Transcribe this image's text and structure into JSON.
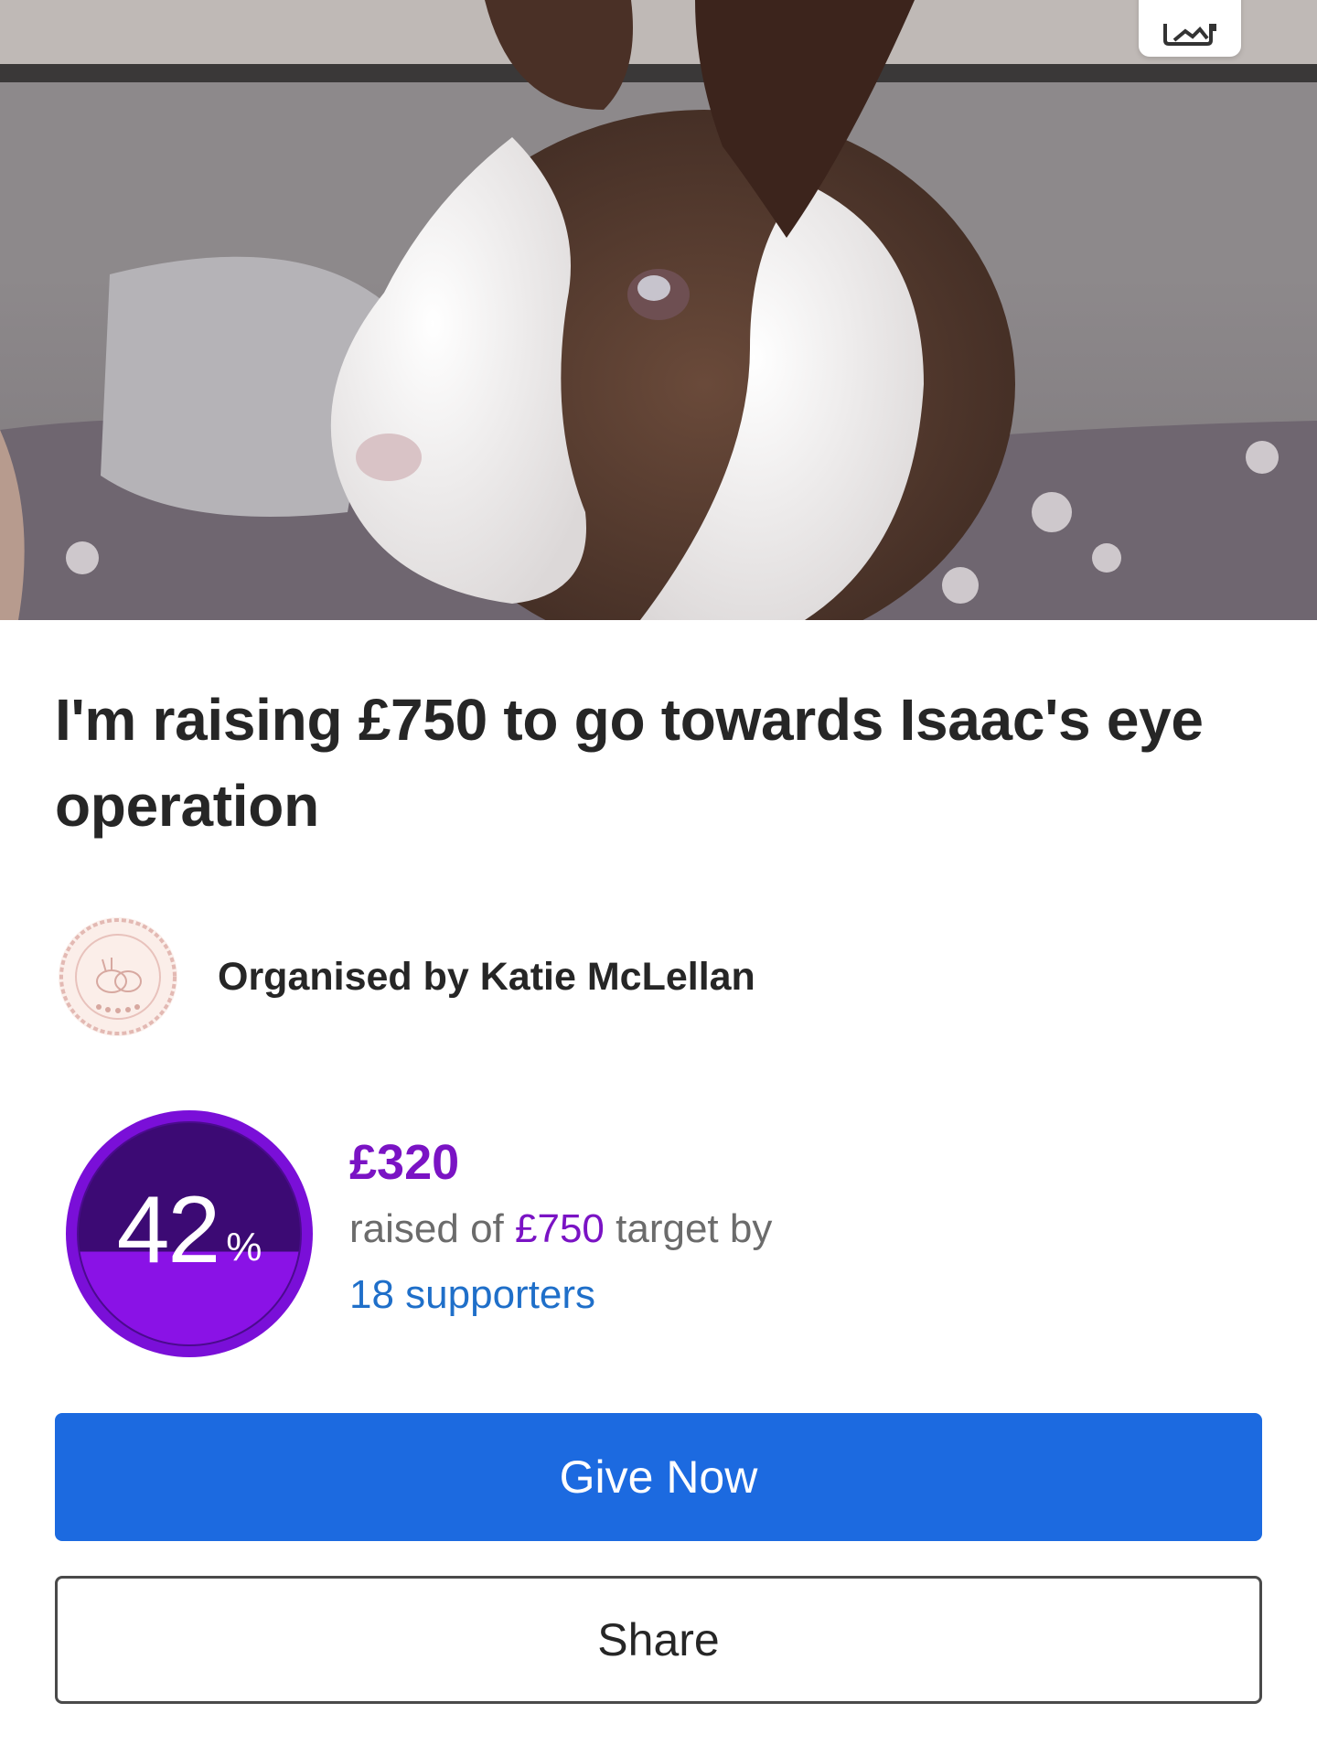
{
  "hero": {
    "image": "rabbit-photo",
    "gallery_icon": "image-gallery-icon"
  },
  "fundraiser": {
    "title": "I'm raising £750 to go towards Isaac's eye operation"
  },
  "organiser": {
    "label": "Organised by Katie McLellan",
    "avatar": "organiser-logo"
  },
  "progress": {
    "percent": "42",
    "percent_sign": "%",
    "fraction": 0.42,
    "raised": "£320",
    "raised_prefix": "raised of",
    "target": "£750",
    "raised_suffix": "target by",
    "supporters": "18 supporters"
  },
  "actions": {
    "give_label": "Give Now",
    "share_label": "Share"
  },
  "colors": {
    "accent_purple": "#7a13c4",
    "ring_dark": "#3c0a74",
    "button_blue": "#1c6ae0",
    "link_blue": "#1f6fc9"
  }
}
